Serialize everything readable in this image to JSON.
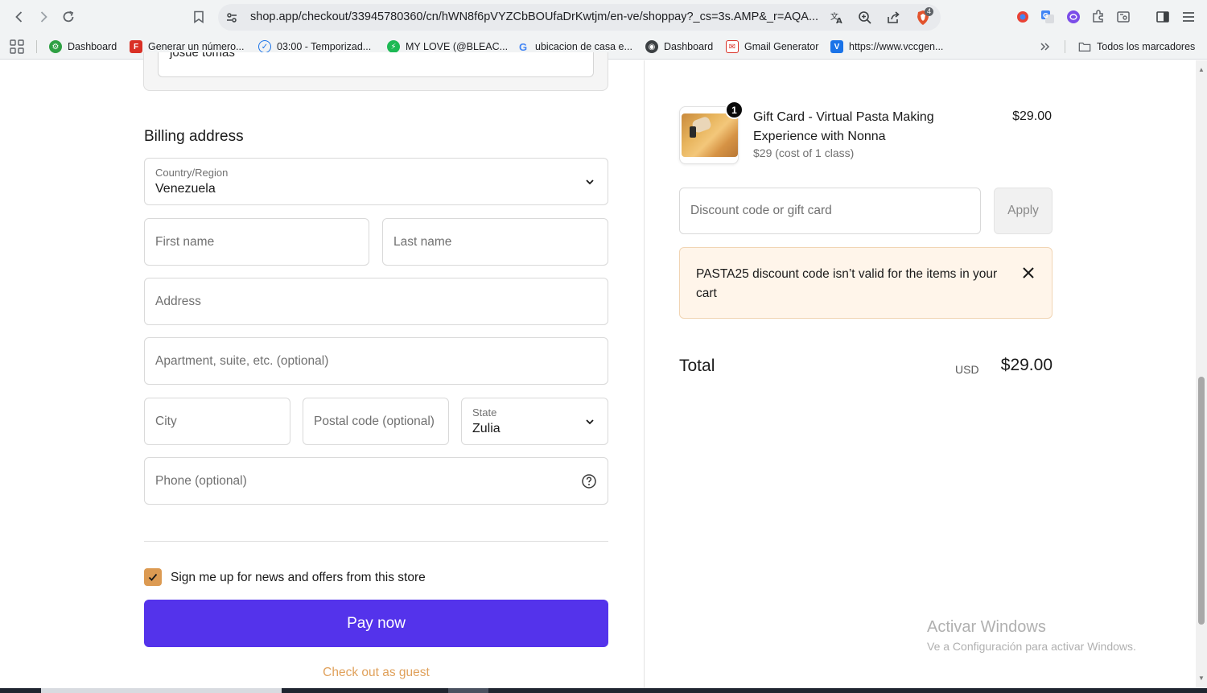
{
  "browser": {
    "url": "shop.app/checkout/33945780360/cn/hWN8f6pVYZCbBOUfaDrKwtjm/en-ve/shoppay?_cs=3s.AMP&_r=AQA...",
    "shield_badge": "4",
    "bookmarks": [
      {
        "label": "Dashboard",
        "icon": "gear-circle-icon",
        "color": "#2ea043"
      },
      {
        "label": "Generar un número...",
        "icon": "f-logo-icon",
        "color": "#d93025"
      },
      {
        "label": "03:00 - Temporizad...",
        "icon": "check-clock-icon",
        "color": "#1a73e8"
      },
      {
        "label": "MY LOVE (@BLEAC...",
        "icon": "bolt-circle-icon",
        "color": "#1db954"
      },
      {
        "label": "ubicacion de casa e...",
        "icon": "google-g-icon",
        "color": "#4285f4"
      },
      {
        "label": "Dashboard",
        "icon": "globe-icon",
        "color": "#3c4043"
      },
      {
        "label": "Gmail Generator",
        "icon": "gmail-icon",
        "color": "#d93025"
      },
      {
        "label": "https://www.vccgen...",
        "icon": "v-logo-icon",
        "color": "#1a73e8"
      }
    ],
    "all_bookmarks": "Todos los marcadores"
  },
  "contact": {
    "name_value": "josue tomas"
  },
  "billing": {
    "title": "Billing address",
    "country_label": "Country/Region",
    "country_value": "Venezuela",
    "first_name_ph": "First name",
    "last_name_ph": "Last name",
    "address_ph": "Address",
    "apartment_ph": "Apartment, suite, etc. (optional)",
    "city_ph": "City",
    "postal_ph": "Postal code (optional)",
    "state_label": "State",
    "state_value": "Zulia",
    "phone_ph": "Phone (optional)"
  },
  "newsletter": {
    "checked": true,
    "label": "Sign me up for news and offers from this store"
  },
  "actions": {
    "pay_now": "Pay now",
    "guest": "Check out as guest"
  },
  "order": {
    "item_title": "Gift Card - Virtual Pasta Making Experience with Nonna",
    "item_sub": "$29 (cost of 1 class)",
    "item_price": "$29.00",
    "quantity": "1",
    "discount_ph": "Discount code or gift card",
    "apply": "Apply",
    "error": "PASTA25 discount code isn’t valid for the items in your cart",
    "total_label": "Total",
    "currency": "USD",
    "total": "$29.00"
  },
  "watermark": {
    "title": "Activar Windows",
    "sub": "Ve a Configuración para activar Windows."
  },
  "colors": {
    "pay_button": "#5433eb",
    "checkbox": "#dc9a52",
    "guest_link": "#e0a15b",
    "alert_bg": "#fff5ea"
  }
}
